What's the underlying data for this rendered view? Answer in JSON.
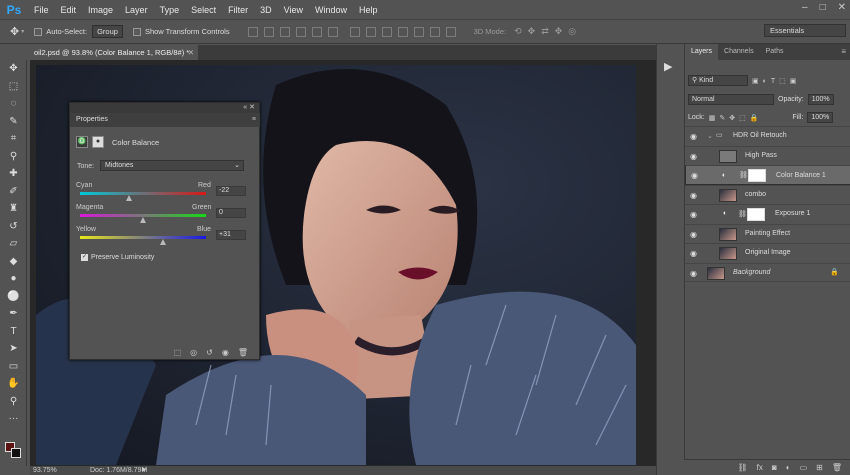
{
  "app": {
    "logo": "Ps"
  },
  "menu": [
    "File",
    "Edit",
    "Image",
    "Layer",
    "Type",
    "Select",
    "Filter",
    "3D",
    "View",
    "Window",
    "Help"
  ],
  "options": {
    "auto_select_label": "Auto-Select:",
    "auto_select_value": "Group",
    "show_transform_label": "Show Transform Controls",
    "mode_3d_label": "3D Mode:",
    "workspace": "Essentials"
  },
  "document": {
    "tab_title": "oil2.psd @ 93.8% (Color Balance 1, RGB/8#) *",
    "zoom": "93.75%",
    "doc_size": "Doc: 1.76M/8.79M"
  },
  "colors": {
    "foreground": "#5a1414",
    "background": "#111111"
  },
  "properties": {
    "tab": "Properties",
    "adjustment": "Color Balance",
    "tone_label": "Tone:",
    "tone_value": "Midtones",
    "sliders": [
      {
        "left": "Cyan",
        "right": "Red",
        "value": "-22",
        "level": -22
      },
      {
        "left": "Magenta",
        "right": "Green",
        "value": "0",
        "level": 0
      },
      {
        "left": "Yellow",
        "right": "Blue",
        "value": "+31",
        "level": 31
      }
    ],
    "preserve_luminosity": "Preserve Luminosity"
  },
  "layers_panel": {
    "tabs": [
      "Layers",
      "Channels",
      "Paths"
    ],
    "filter_kind": "Kind",
    "blend_mode": "Normal",
    "opacity_label": "Opacity:",
    "opacity_value": "100%",
    "lock_label": "Lock:",
    "fill_label": "Fill:",
    "fill_value": "100%",
    "layers": [
      {
        "name": "HDR Oil Retouch",
        "type": "group"
      },
      {
        "name": "High Pass",
        "type": "layer"
      },
      {
        "name": "Color Balance 1",
        "type": "adjustment",
        "selected": true
      },
      {
        "name": "combo",
        "type": "layer"
      },
      {
        "name": "Exposure 1",
        "type": "adjustment"
      },
      {
        "name": "Painting Effect",
        "type": "layer"
      },
      {
        "name": "Original Image",
        "type": "layer"
      },
      {
        "name": "Background",
        "type": "background"
      }
    ]
  }
}
